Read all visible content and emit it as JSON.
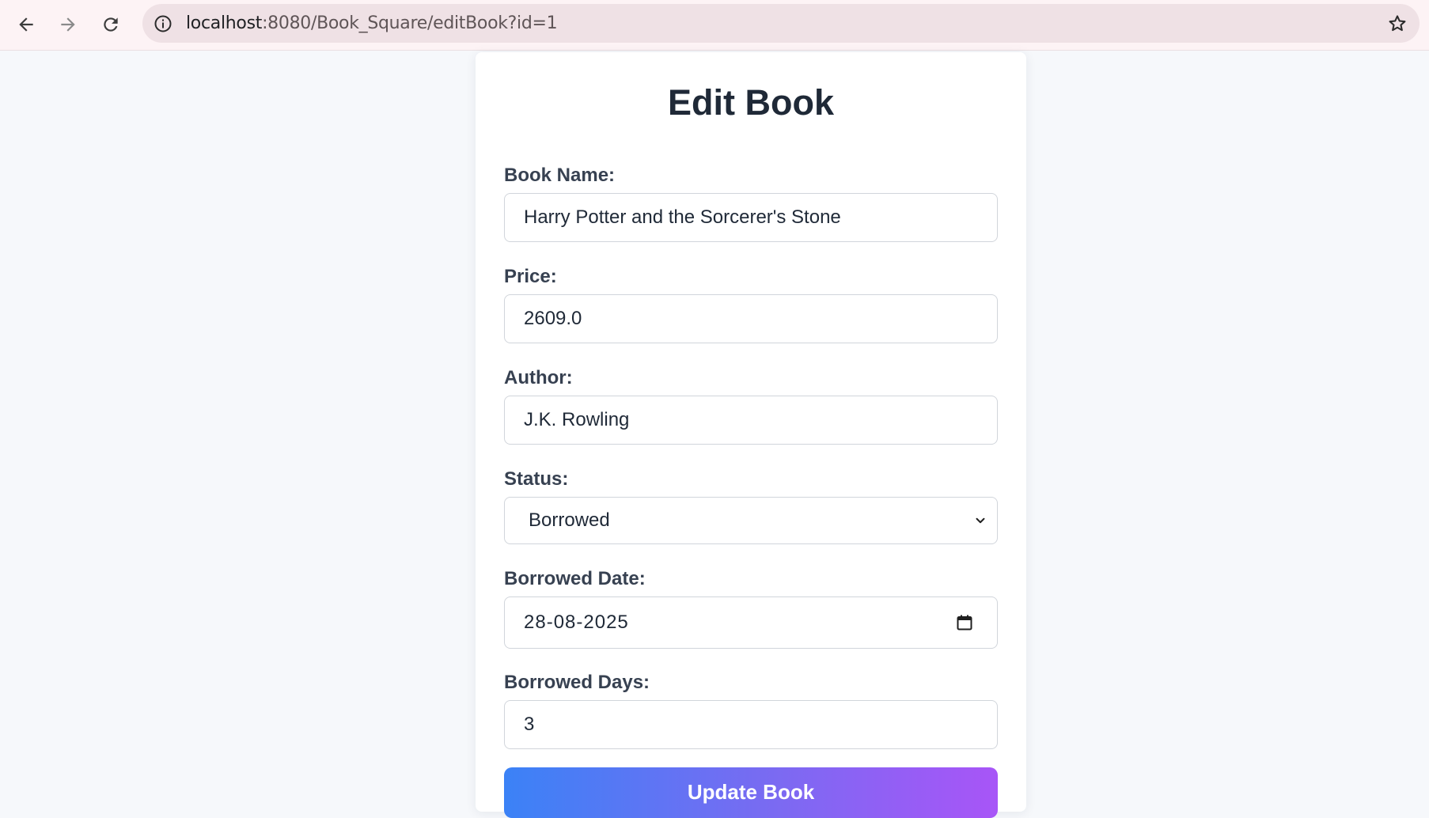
{
  "browser": {
    "url_host": "localhost",
    "url_rest": ":8080/Book_Square/editBook?id=1",
    "icons": [
      "back-arrow-icon",
      "forward-arrow-icon",
      "reload-icon",
      "info-icon",
      "star-icon"
    ]
  },
  "form": {
    "title": "Edit Book",
    "book_name": {
      "label": "Book Name:",
      "value": "Harry Potter and the Sorcerer's Stone"
    },
    "price": {
      "label": "Price:",
      "value": "2609.0"
    },
    "author": {
      "label": "Author:",
      "value": "J.K. Rowling"
    },
    "status": {
      "label": "Status:",
      "value": "Borrowed"
    },
    "borrowed_date": {
      "label": "Borrowed Date:",
      "value": "28-08-2025"
    },
    "borrowed_days": {
      "label": "Borrowed Days:",
      "value": "3"
    },
    "submit_label": "Update Book"
  },
  "colors": {
    "page_bg": "#f6f8fb",
    "heading": "#1f2937",
    "button_gradient_start": "#3b82f6",
    "button_gradient_end": "#a855f7"
  }
}
